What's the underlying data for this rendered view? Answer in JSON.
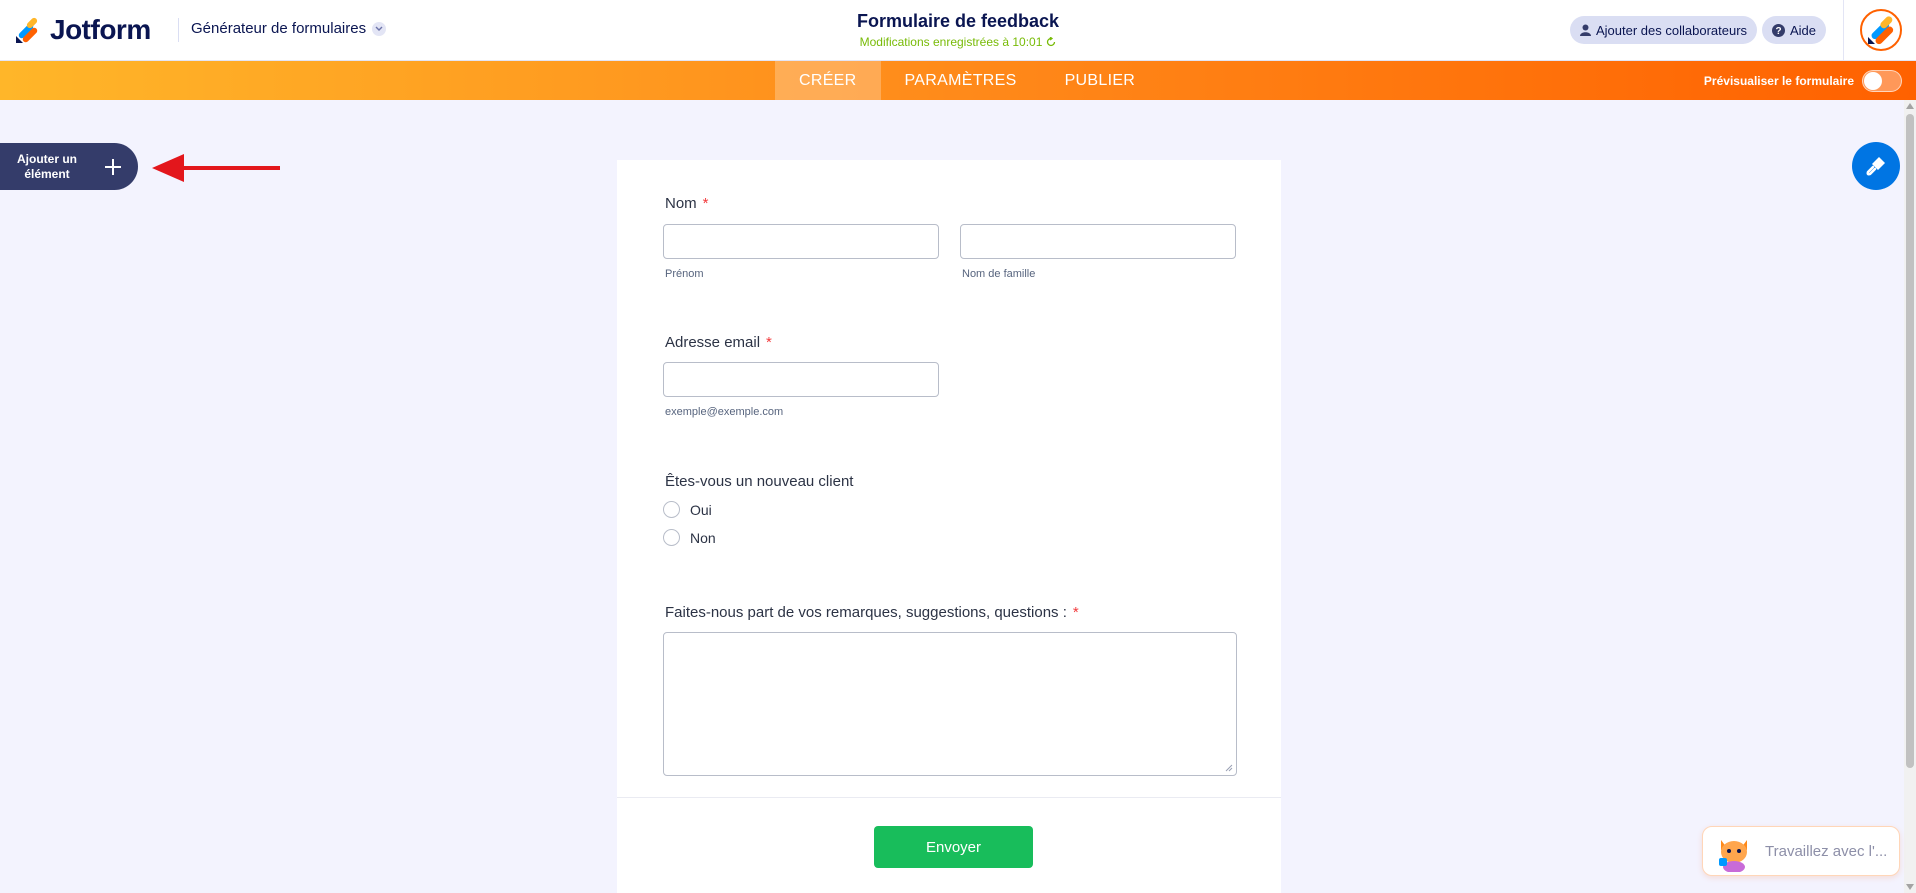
{
  "header": {
    "brand": "Jotform",
    "builder_menu": "Générateur de formulaires",
    "form_title": "Formulaire de feedback",
    "saved_status": "Modifications enregistrées à 10:01",
    "collaborators_button": "Ajouter des collaborateurs",
    "help_button": "Aide"
  },
  "nav": {
    "tabs": [
      {
        "label": "CRÉER",
        "active": true
      },
      {
        "label": "PARAMÈTRES",
        "active": false
      },
      {
        "label": "PUBLIER",
        "active": false
      }
    ],
    "preview_label": "Prévisualiser le formulaire",
    "preview_enabled": false
  },
  "sidebar": {
    "add_element_line1": "Ajouter un",
    "add_element_line2": "élément"
  },
  "form": {
    "name_label": "Nom",
    "name_required": "*",
    "first_name_sublabel": "Prénom",
    "last_name_sublabel": "Nom de famille",
    "email_label": "Adresse email",
    "email_required": "*",
    "email_sublabel": "exemple@exemple.com",
    "new_client_label": "Êtes-vous un nouveau client",
    "new_client_options": [
      "Oui",
      "Non"
    ],
    "comments_label": "Faites-nous part de vos remarques, suggestions, questions :",
    "comments_required": "*",
    "submit_label": "Envoyer"
  },
  "ai_agent": {
    "text": "Travaillez avec l'..."
  },
  "colors": {
    "brand_orange": "#ff6100",
    "submit_green": "#18bd5b",
    "designer_blue": "#0075e3",
    "saved_green": "#78bb07",
    "required_red": "#f23a3c"
  }
}
